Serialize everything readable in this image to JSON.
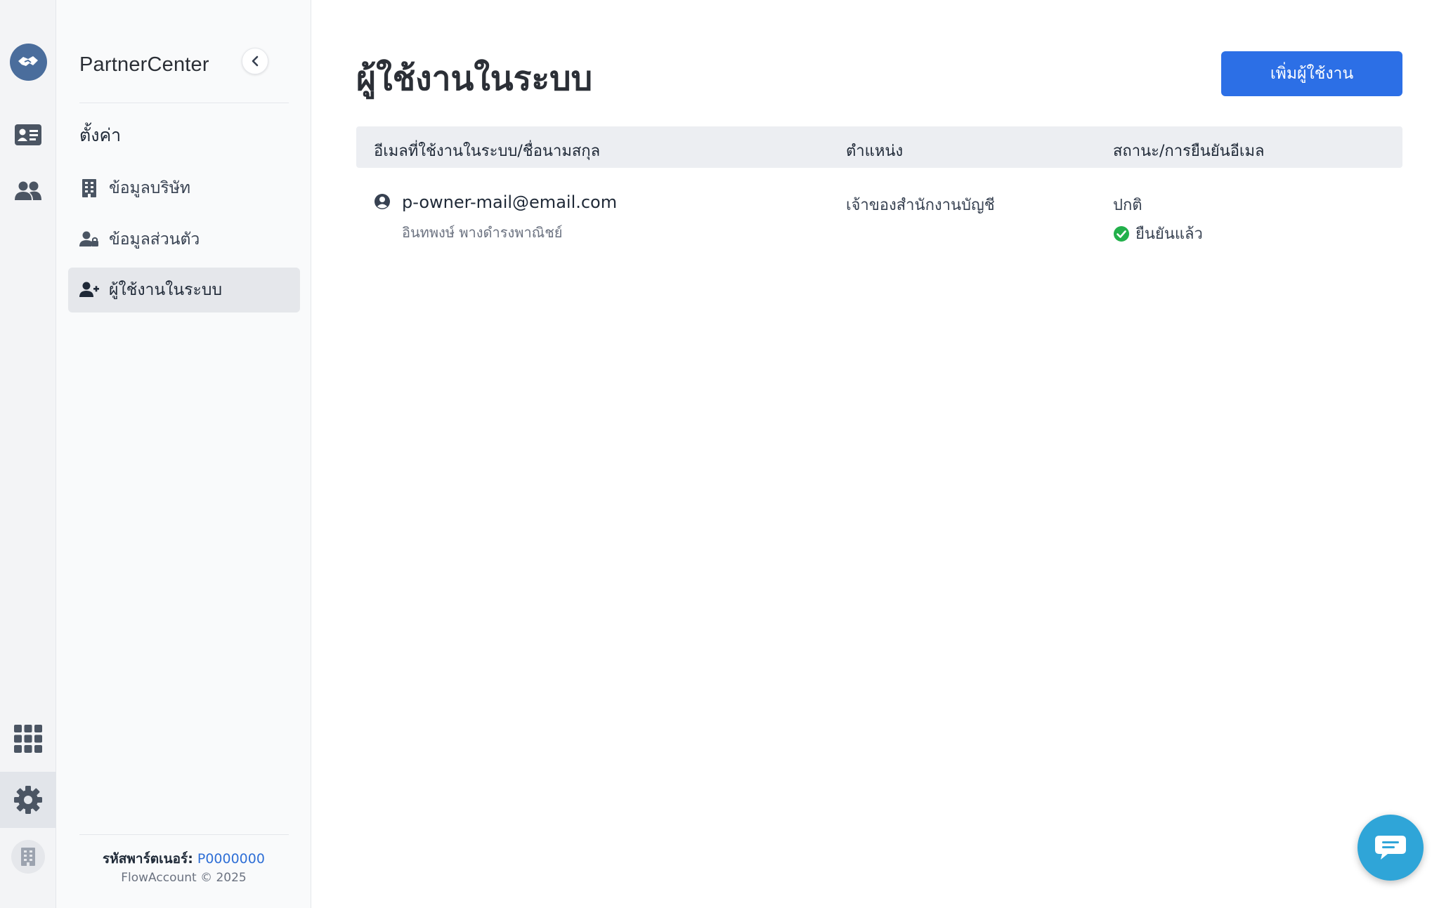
{
  "rail": {
    "items": [
      {
        "icon": "handshake-logo-icon"
      },
      {
        "icon": "contact-card-icon"
      },
      {
        "icon": "users-icon"
      },
      {
        "icon": "apps-grid-icon"
      },
      {
        "icon": "gear-icon",
        "active": true
      },
      {
        "icon": "building-icon"
      }
    ]
  },
  "sidebar": {
    "brand": "PartnerCenter",
    "section_title": "ตั้งค่า",
    "items": [
      {
        "label": "ข้อมูลบริษัท",
        "icon": "building-icon"
      },
      {
        "label": "ข้อมูลส่วนตัว",
        "icon": "user-lock-icon"
      },
      {
        "label": "ผู้ใช้งานในระบบ",
        "icon": "user-plus-icon",
        "active": true
      }
    ],
    "footer": {
      "partner_code_label": "รหัสพาร์ตเนอร์:",
      "partner_code_value": "P0000000",
      "copyright": "FlowAccount © 2025"
    }
  },
  "main": {
    "title": "ผู้ใช้งานในระบบ",
    "add_button": "เพิ่มผู้ใช้งาน",
    "table": {
      "columns": [
        "อีเมลที่ใช้งานในระบบ/ชื่อนามสกุล",
        "ตำแหน่ง",
        "สถานะ/การยืนยันอีเมล"
      ],
      "rows": [
        {
          "email": "p-owner-mail@email.com",
          "name": "อินทพงษ์ พางดำรงพาณิชย์",
          "position": "เจ้าของสำนักงานบัญชี",
          "status": "ปกติ",
          "verification": "ยืนยันแล้ว"
        }
      ]
    }
  },
  "colors": {
    "primary": "#2c6fe6",
    "rail_logo": "#4a6d9c",
    "verified_green": "#22b04b",
    "chat": "#2fa5d8",
    "link": "#2f6fd6"
  }
}
